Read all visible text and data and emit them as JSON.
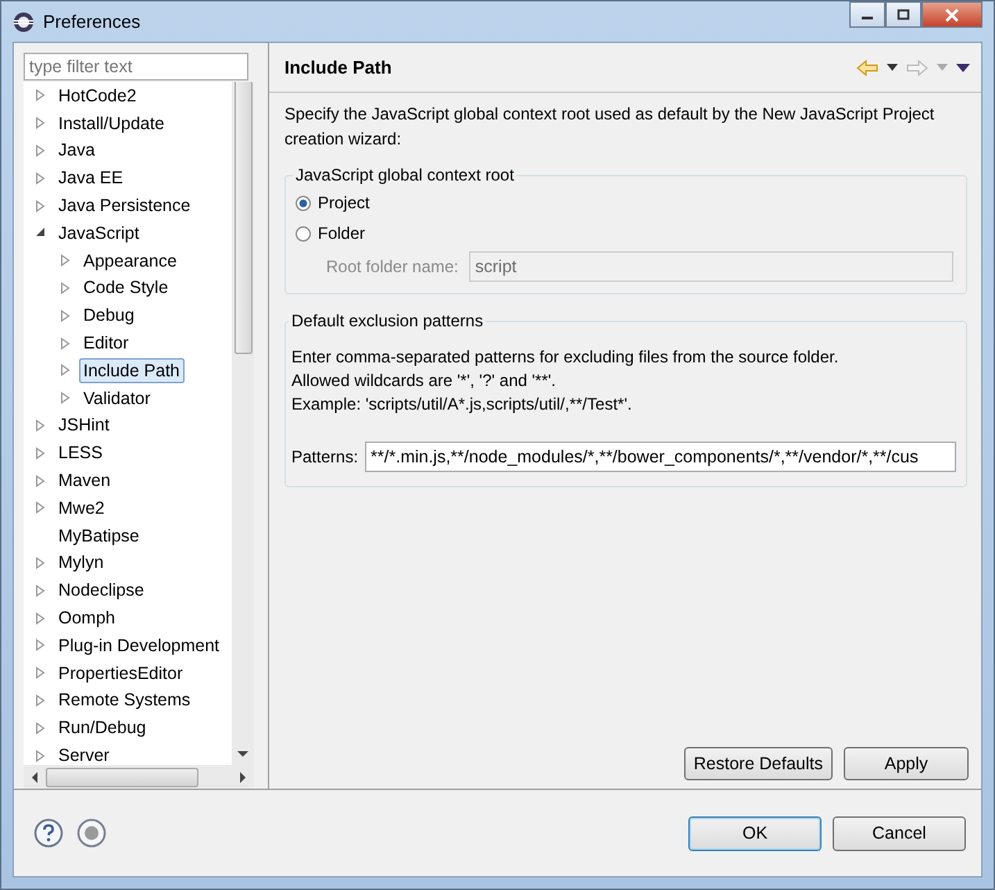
{
  "window": {
    "title": "Preferences"
  },
  "filter": {
    "placeholder": "type filter text"
  },
  "tree": [
    {
      "label": "HotCode2",
      "kind": "folder",
      "expanded": false,
      "selected": false
    },
    {
      "label": "Install/Update",
      "kind": "folder",
      "expanded": false,
      "selected": false
    },
    {
      "label": "Java",
      "kind": "folder",
      "expanded": false,
      "selected": false
    },
    {
      "label": "Java EE",
      "kind": "folder",
      "expanded": false,
      "selected": false
    },
    {
      "label": "Java Persistence",
      "kind": "folder",
      "expanded": false,
      "selected": false
    },
    {
      "label": "JavaScript",
      "kind": "folder",
      "expanded": true,
      "selected": false,
      "children": [
        {
          "label": "Appearance",
          "kind": "folder",
          "expanded": false,
          "selected": false
        },
        {
          "label": "Code Style",
          "kind": "folder",
          "expanded": false,
          "selected": false
        },
        {
          "label": "Debug",
          "kind": "folder",
          "expanded": false,
          "selected": false
        },
        {
          "label": "Editor",
          "kind": "folder",
          "expanded": false,
          "selected": false
        },
        {
          "label": "Include Path",
          "kind": "folder",
          "expanded": false,
          "selected": true
        },
        {
          "label": "Validator",
          "kind": "folder",
          "expanded": false,
          "selected": false
        }
      ]
    },
    {
      "label": "JSHint",
      "kind": "folder",
      "expanded": false,
      "selected": false
    },
    {
      "label": "LESS",
      "kind": "folder",
      "expanded": false,
      "selected": false
    },
    {
      "label": "Maven",
      "kind": "folder",
      "expanded": false,
      "selected": false
    },
    {
      "label": "Mwe2",
      "kind": "folder",
      "expanded": false,
      "selected": false
    },
    {
      "label": "MyBatipse",
      "kind": "leaf",
      "selected": false
    },
    {
      "label": "Mylyn",
      "kind": "folder",
      "expanded": false,
      "selected": false
    },
    {
      "label": "Nodeclipse",
      "kind": "folder",
      "expanded": false,
      "selected": false
    },
    {
      "label": "Oomph",
      "kind": "folder",
      "expanded": false,
      "selected": false
    },
    {
      "label": "Plug-in Development",
      "kind": "folder",
      "expanded": false,
      "selected": false
    },
    {
      "label": "PropertiesEditor",
      "kind": "folder",
      "expanded": false,
      "selected": false
    },
    {
      "label": "Remote Systems",
      "kind": "folder",
      "expanded": false,
      "selected": false
    },
    {
      "label": "Run/Debug",
      "kind": "folder",
      "expanded": false,
      "selected": false
    },
    {
      "label": "Server",
      "kind": "folder",
      "expanded": false,
      "selected": false
    }
  ],
  "page": {
    "title": "Include Path",
    "description": "Specify the JavaScript global context root used as default by the New JavaScript Project creation wizard:",
    "context_root": {
      "title": "JavaScript global context root",
      "options": [
        {
          "label": "Project",
          "selected": true
        },
        {
          "label": "Folder",
          "selected": false
        }
      ],
      "root_folder": {
        "label": "Root folder name:",
        "value": "script",
        "disabled": true
      }
    },
    "exclusion": {
      "title": "Default exclusion patterns",
      "lines": [
        "Enter comma-separated patterns for excluding files from the source folder.",
        "Allowed wildcards are '*', '?' and '**'.",
        "Example: 'scripts/util/A*.js,scripts/util/,**/Test*'."
      ],
      "patterns": {
        "label": "Patterns:",
        "value": "**/*.min.js,**/node_modules/*,**/bower_components/*,**/vendor/*,**/cus"
      }
    },
    "buttons": [
      "Restore Defaults",
      "Apply"
    ]
  },
  "footer_buttons": [
    {
      "label": "OK",
      "selected": true
    },
    {
      "label": "Cancel",
      "selected": false
    }
  ]
}
